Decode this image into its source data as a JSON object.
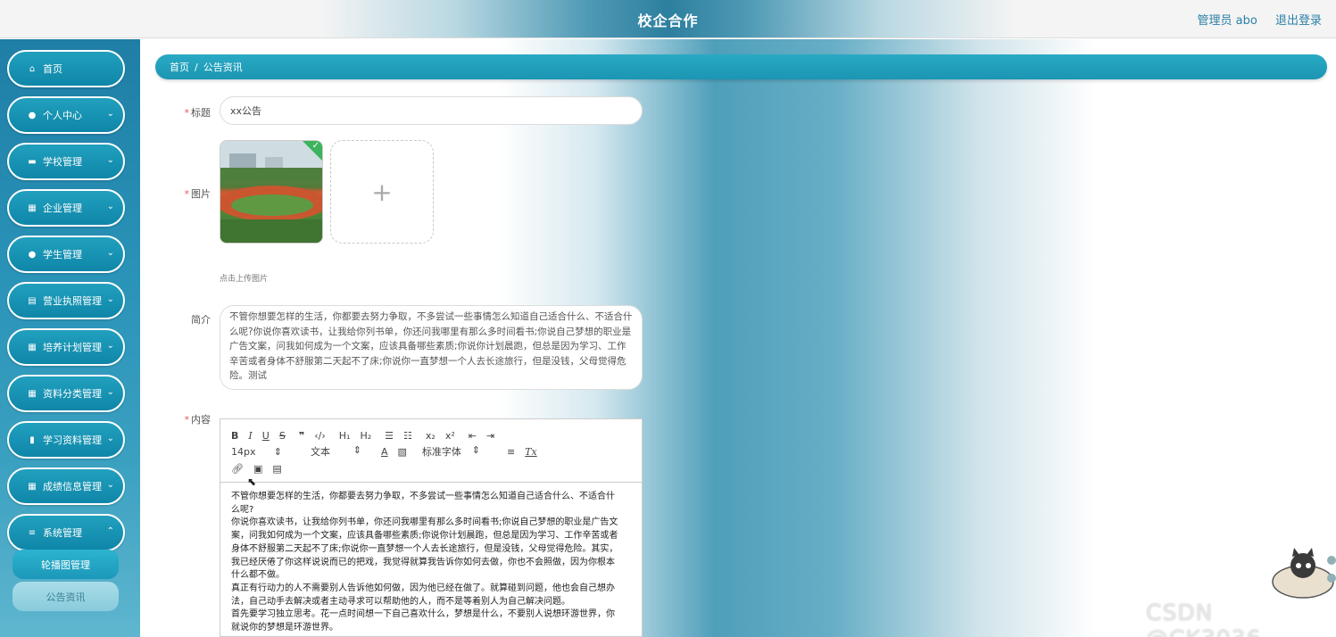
{
  "header": {
    "title": "校企合作",
    "user_label": "管理员 abo",
    "logout_label": "退出登录"
  },
  "sidebar": {
    "items": [
      {
        "label": "首页",
        "icon": "home-icon"
      },
      {
        "label": "个人中心",
        "icon": "user-icon"
      },
      {
        "label": "学校管理",
        "icon": "briefcase-icon"
      },
      {
        "label": "企业管理",
        "icon": "grid-icon"
      },
      {
        "label": "学生管理",
        "icon": "user-icon"
      },
      {
        "label": "营业执照管理",
        "icon": "clipboard-icon"
      },
      {
        "label": "培养计划管理",
        "icon": "grid-icon"
      },
      {
        "label": "资料分类管理",
        "icon": "grid-icon"
      },
      {
        "label": "学习资料管理",
        "icon": "chart-icon"
      },
      {
        "label": "成绩信息管理",
        "icon": "grid-icon"
      },
      {
        "label": "系统管理",
        "icon": "sliders-icon"
      }
    ],
    "sub_items": [
      {
        "label": "轮播图管理"
      },
      {
        "label": "公告资讯"
      }
    ]
  },
  "breadcrumb": {
    "home": "首页",
    "separator": "/",
    "current": "公告资讯"
  },
  "form": {
    "title_label": "标题",
    "title_value": "xx公告",
    "image_label": "图片",
    "upload_hint": "点击上传图片",
    "intro_label": "简介",
    "intro_value": "不管你想要怎样的生活，你都要去努力争取，不多尝试一些事情怎么知道自己适合什么、不适合什么呢?你说你喜欢读书，让我给你列书单，你还问我哪里有那么多时间看书;你说自己梦想的职业是广告文案，问我如何成为一个文案，应该具备哪些素质;你说你计划晨跑，但总是因为学习、工作辛苦或者身体不舒服第二天起不了床;你说你一直梦想一个人去长途旅行，但是没钱，父母觉得危险。测试",
    "content_label": "内容"
  },
  "editor": {
    "font_size": "14px",
    "text_type": "文本",
    "font_family": "标准字体",
    "content_lines": [
      "不管你想要怎样的生活，你都要去努力争取，不多尝试一些事情怎么知道自己适合什么、不适合什",
      "么呢?",
      "你说你喜欢读书，让我给你列书单，你还问我哪里有那么多时间看书;你说自己梦想的职业是广告文",
      "案，问我如何成为一个文案，应该具备哪些素质;你说你计划晨跑，但总是因为学习、工作辛苦或者",
      "身体不舒服第二天起不了床;你说你一直梦想一个人去长途旅行，但是没钱，父母觉得危险。其实，",
      "我已经厌倦了你这样说说而已的把戏，我觉得就算我告诉你如何去做，你也不会照做，因为你根本",
      "什么都不做。",
      "真正有行动力的人不需要别人告诉他如何做，因为他已经在做了。就算碰到问题，他也会自己想办",
      "法，自己动手去解决或者主动寻求可以帮助他的人，而不是等着别人为自己解决问题。",
      "首先要学习独立思考。花一点时间想一下自己喜欢什么，梦想是什么，不要别人说想环游世界，你",
      "就说你的梦想是环游世界。"
    ]
  },
  "watermark": "CSDN @CK3036"
}
